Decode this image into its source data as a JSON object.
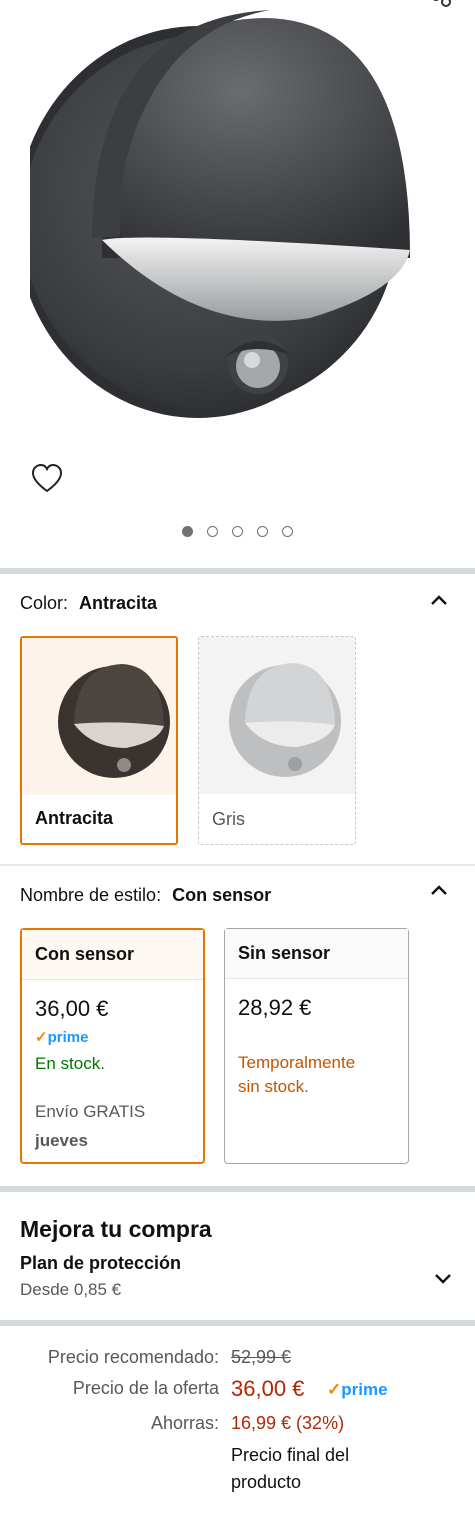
{
  "gallery": {
    "dot_count": 5,
    "active_dot": 0
  },
  "color": {
    "label": "Color:",
    "selected": "Antracita",
    "options": [
      {
        "name": "Antracita",
        "selected": true
      },
      {
        "name": "Gris",
        "selected": false
      }
    ]
  },
  "style": {
    "label": "Nombre de estilo:",
    "selected": "Con sensor",
    "options": [
      {
        "name": "Con sensor",
        "price": "36,00 €",
        "prime": "prime",
        "stock": "En stock.",
        "shipping": "Envío GRATIS",
        "delivery": "jueves",
        "selected": true
      },
      {
        "name": "Sin sensor",
        "price": "28,92 €",
        "stock_line1": "Temporalmente",
        "stock_line2": "sin stock.",
        "selected": false
      }
    ]
  },
  "upgrade": {
    "title": "Mejora tu compra",
    "plan": "Plan de protección",
    "from": "Desde 0,85 €"
  },
  "pricing": {
    "rec_label": "Precio recomendado:",
    "rec_value": "52,99 €",
    "deal_label": "Precio de la oferta",
    "deal_value": "36,00 €",
    "prime": "prime",
    "save_label": "Ahorras:",
    "save_value": "16,99 € (32%)",
    "final_line1": "Precio final del",
    "final_line2": "producto"
  },
  "colors": {
    "deal_red": "#b12704",
    "stock_green": "#007600",
    "unavailable_orange": "#c45500",
    "selected_border": "#e77600",
    "prime_blue": "#1a98ff"
  }
}
